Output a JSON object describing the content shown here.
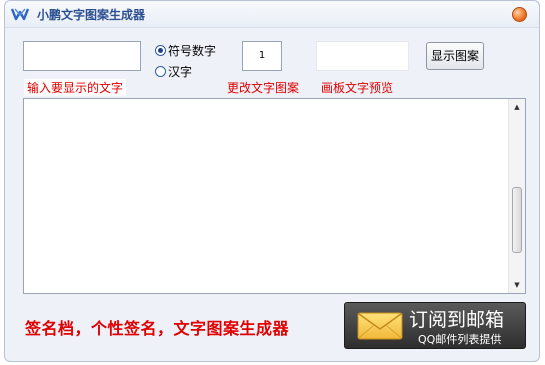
{
  "window": {
    "title": "小鹏文字图案生成器",
    "icon": "app-logo-icon",
    "close_icon": "close-icon"
  },
  "controls": {
    "text_input_value": "",
    "radio_symbols_label": "符号数字",
    "radio_chinese_label": "汉字",
    "radio_selected": "符号数字",
    "number_value": "1",
    "show_button_label": "显示图案"
  },
  "labels": {
    "input_hint": "输入要显示的文字",
    "change_pattern": "更改文字图案",
    "preview_label": "画板文字预览"
  },
  "output": {
    "content": ""
  },
  "footer": {
    "tagline": "签名档，个性签名，文字图案生成器",
    "subscribe_main": "订阅到邮箱",
    "subscribe_sub": "QQ邮件列表提供",
    "subscribe_icon": "envelope-icon"
  },
  "colors": {
    "accent_red": "#e00000",
    "title_blue": "#2b4f91",
    "banner_dark": "#3a3a3a"
  }
}
